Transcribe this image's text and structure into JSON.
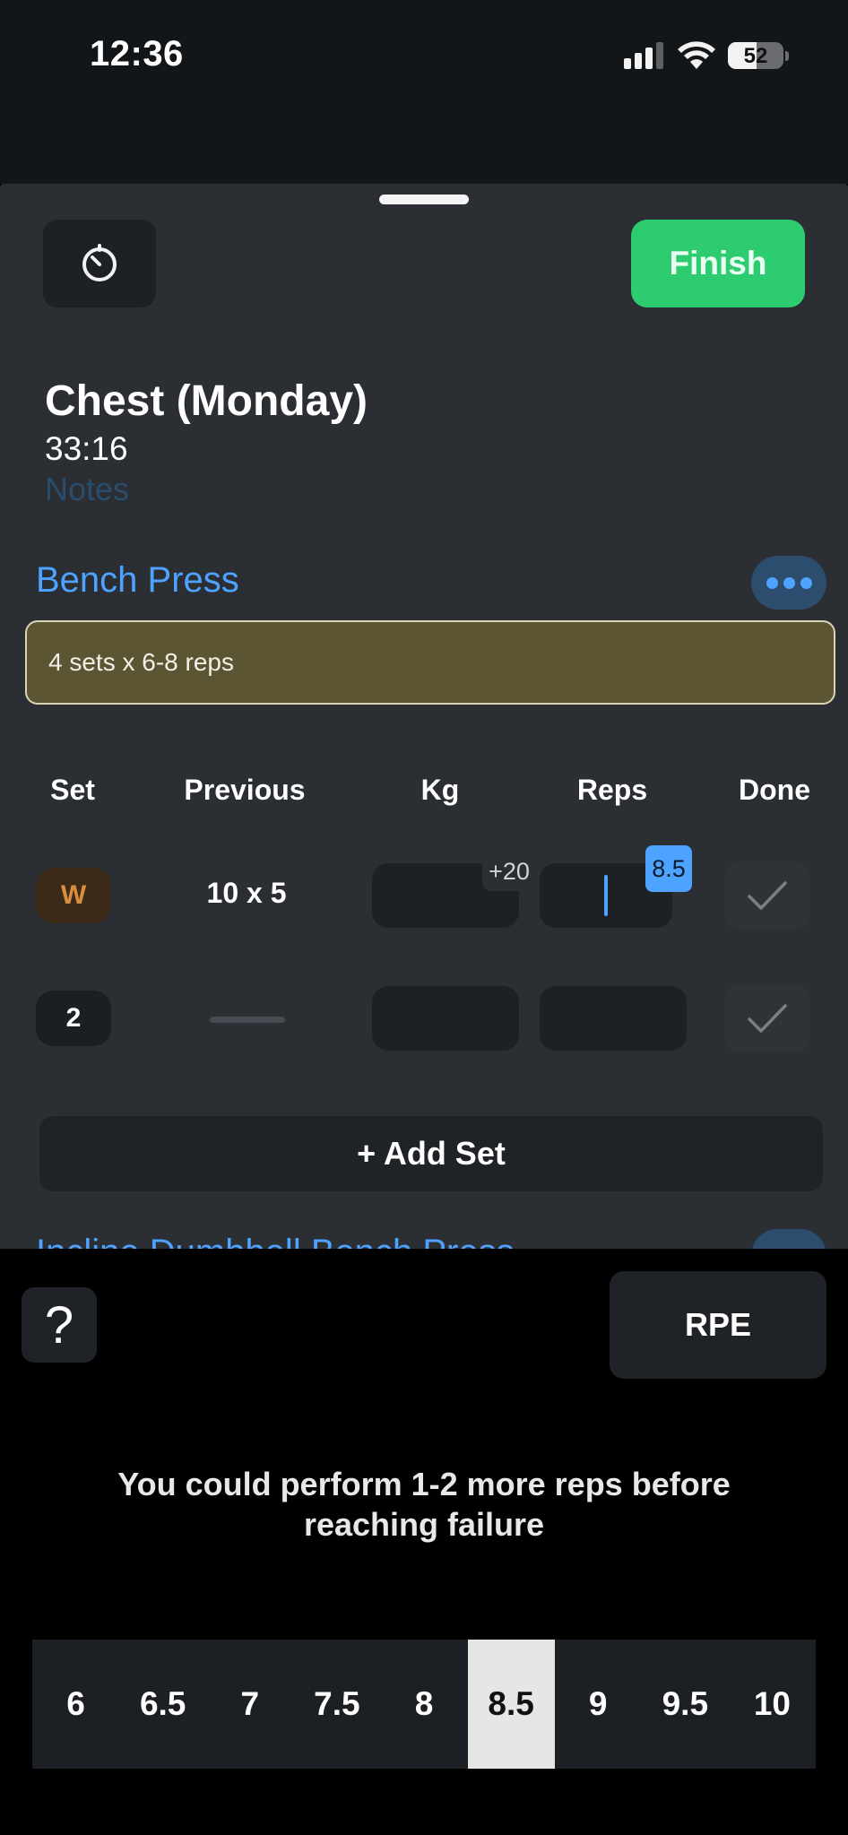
{
  "status_bar": {
    "time": "12:36",
    "battery": "52"
  },
  "toolbar": {
    "finish_label": "Finish"
  },
  "workout": {
    "title": "Chest (Monday)",
    "duration": "33:16",
    "notes_placeholder": "Notes"
  },
  "exercise": {
    "name": "Bench Press",
    "note": "4 sets x 6-8 reps",
    "columns": {
      "set": "Set",
      "previous": "Previous",
      "kg": "Kg",
      "reps": "Reps",
      "done": "Done"
    },
    "sets": [
      {
        "label": "W",
        "previous": "10 x 5",
        "kg_increment": "+20",
        "rpe": "8.5"
      },
      {
        "label": "2",
        "previous": ""
      }
    ],
    "add_set_label": "+ Add Set",
    "next_exercise_name": "Incline Dumbbell Bench Press"
  },
  "rpe_panel": {
    "help_label": "?",
    "mode_label": "RPE",
    "description": "You could perform 1-2 more reps before reaching failure",
    "options": [
      "6",
      "6.5",
      "7",
      "7.5",
      "8",
      "8.5",
      "9",
      "9.5",
      "10"
    ],
    "selected": "8.5"
  },
  "colors": {
    "accent_blue": "#4da3ff",
    "finish_green": "#2ecc71",
    "warmup_orange": "#d88e3c",
    "note_bg": "#5c5534"
  }
}
